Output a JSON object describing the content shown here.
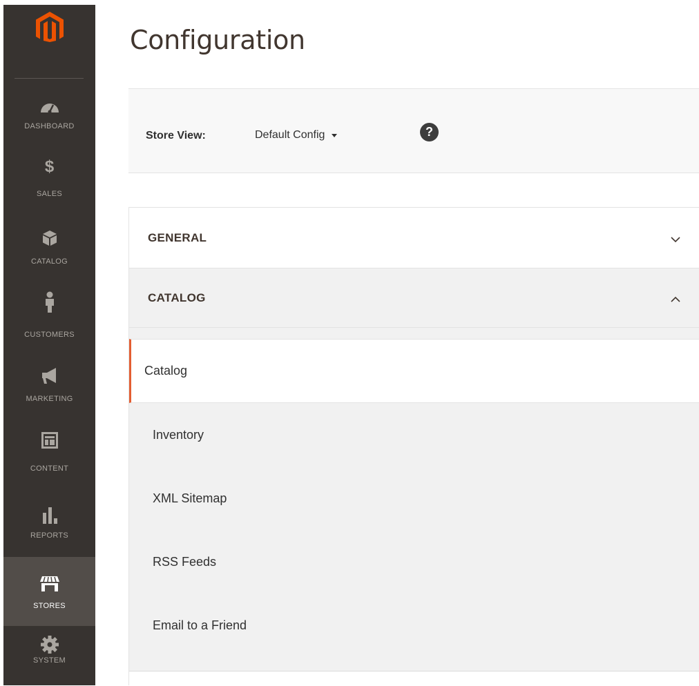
{
  "sidebar": {
    "items": [
      {
        "label": "DASHBOARD",
        "icon": "gauge-icon",
        "active": false
      },
      {
        "label": "SALES",
        "icon": "dollar-icon",
        "active": false
      },
      {
        "label": "CATALOG",
        "icon": "box-icon",
        "active": false
      },
      {
        "label": "CUSTOMERS",
        "icon": "person-icon",
        "active": false
      },
      {
        "label": "MARKETING",
        "icon": "megaphone-icon",
        "active": false
      },
      {
        "label": "CONTENT",
        "icon": "layout-icon",
        "active": false
      },
      {
        "label": "REPORTS",
        "icon": "bar-chart-icon",
        "active": false
      },
      {
        "label": "STORES",
        "icon": "storefront-icon",
        "active": true
      },
      {
        "label": "SYSTEM",
        "icon": "gear-icon",
        "active": false
      }
    ]
  },
  "page": {
    "title": "Configuration"
  },
  "scope": {
    "label": "Store View:",
    "value": "Default Config",
    "help": "?"
  },
  "tabs": {
    "general": {
      "label": "GENERAL",
      "expanded": false
    },
    "catalog": {
      "label": "CATALOG",
      "expanded": true,
      "items": [
        {
          "label": "Catalog",
          "active": true
        },
        {
          "label": "Inventory",
          "active": false
        },
        {
          "label": "XML Sitemap",
          "active": false
        },
        {
          "label": "RSS Feeds",
          "active": false
        },
        {
          "label": "Email to a Friend",
          "active": false
        }
      ]
    }
  },
  "colors": {
    "sidebar_bg": "#373330",
    "sidebar_active": "#524d49",
    "logo": "#eb5202",
    "active_accent": "#e35e32"
  }
}
